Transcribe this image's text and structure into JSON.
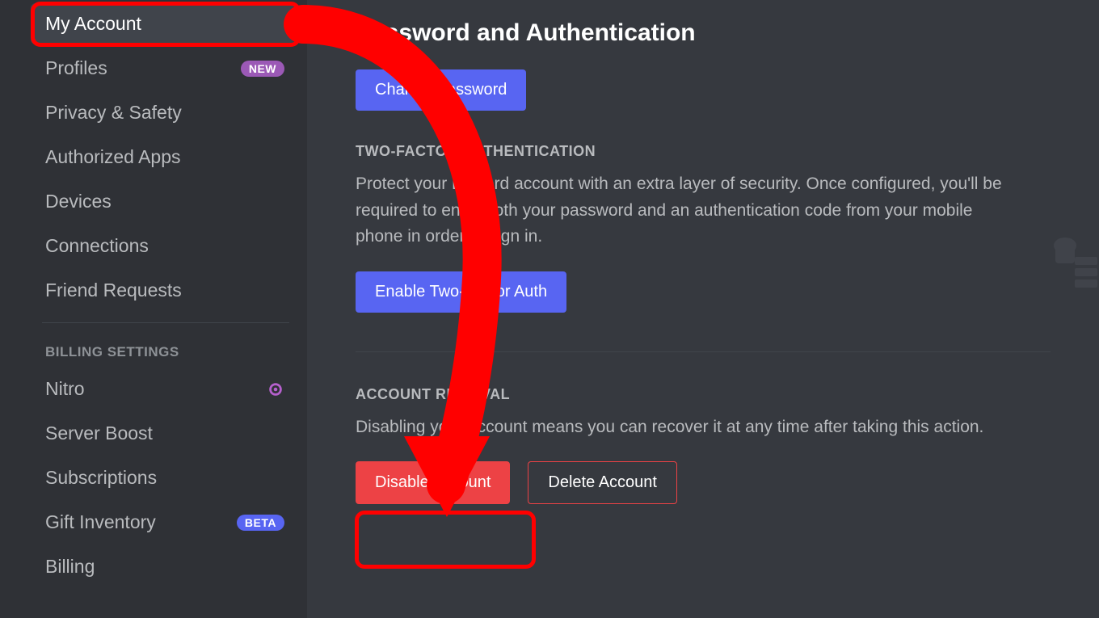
{
  "sidebar": {
    "items": [
      {
        "label": "My Account",
        "active": true
      },
      {
        "label": "Profiles",
        "badge": "NEW",
        "badge_type": "new"
      },
      {
        "label": "Privacy & Safety"
      },
      {
        "label": "Authorized Apps"
      },
      {
        "label": "Devices"
      },
      {
        "label": "Connections"
      },
      {
        "label": "Friend Requests"
      }
    ],
    "billing_header": "BILLING SETTINGS",
    "billing_items": [
      {
        "label": "Nitro",
        "nitro_icon": true
      },
      {
        "label": "Server Boost"
      },
      {
        "label": "Subscriptions"
      },
      {
        "label": "Gift Inventory",
        "badge": "BETA",
        "badge_type": "beta"
      },
      {
        "label": "Billing"
      }
    ]
  },
  "content": {
    "page_title": "Password and Authentication",
    "change_password_btn": "Change Password",
    "twofa_header": "TWO-FACTOR AUTHENTICATION",
    "twofa_body": "Protect your Discord account with an extra layer of security. Once configured, you'll be required to enter both your password and an authentication code from your mobile phone in order to sign in.",
    "enable_2fa_btn": "Enable Two-Factor Auth",
    "removal_header": "ACCOUNT REMOVAL",
    "removal_body": "Disabling your account means you can recover it at any time after taking this action.",
    "disable_btn": "Disable Account",
    "delete_btn": "Delete Account"
  },
  "annotation": {
    "highlight1": "my-account-sidebar-highlight",
    "highlight2": "disable-account-highlight",
    "arrow": "instruction-arrow"
  },
  "colors": {
    "brand": "#5865f2",
    "danger": "#ed4245",
    "annotation": "#ff0000"
  }
}
